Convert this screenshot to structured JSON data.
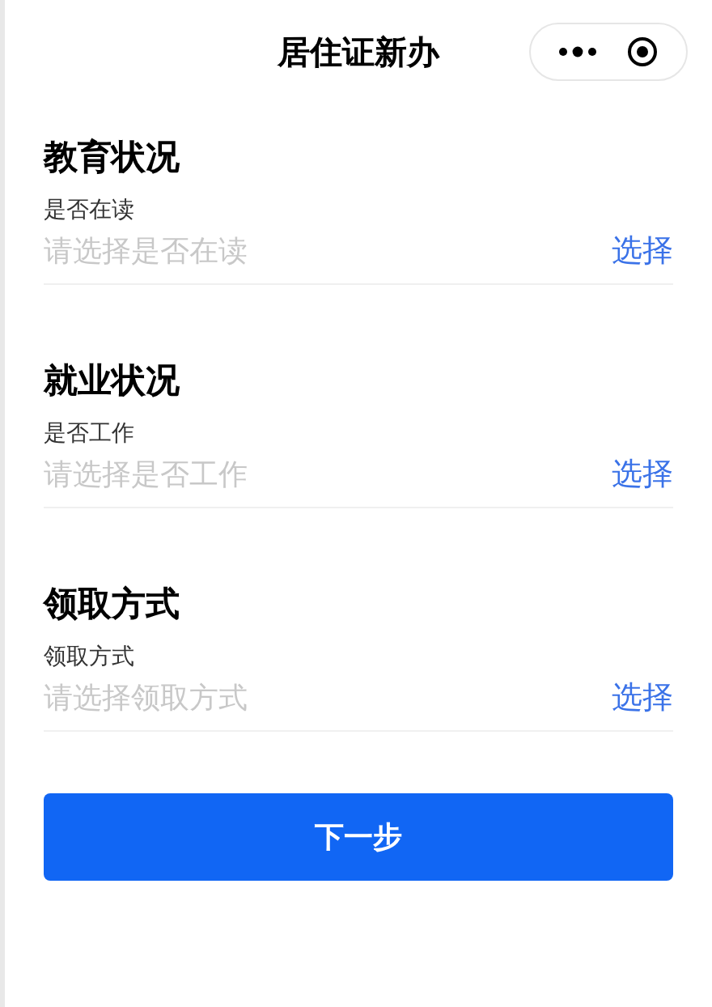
{
  "header": {
    "title": "居住证新办"
  },
  "sections": [
    {
      "heading": "教育状况",
      "label": "是否在读",
      "placeholder": "请选择是否在读",
      "action": "选择"
    },
    {
      "heading": "就业状况",
      "label": "是否工作",
      "placeholder": "请选择是否工作",
      "action": "选择"
    },
    {
      "heading": "领取方式",
      "label": "领取方式",
      "placeholder": "请选择领取方式",
      "action": "选择"
    }
  ],
  "button": {
    "label": "下一步"
  }
}
